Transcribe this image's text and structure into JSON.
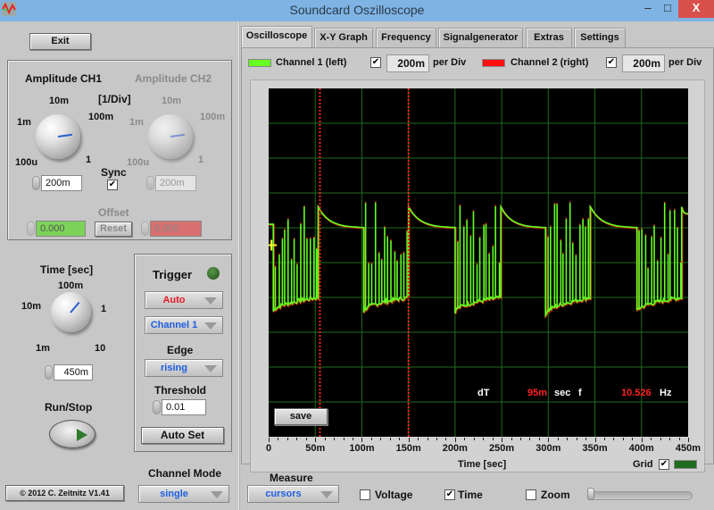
{
  "window": {
    "title": "Soundcard Oszilloscope",
    "minimize": "–",
    "maximize": "□",
    "close": "X"
  },
  "left": {
    "exit_label": "Exit",
    "amplitude": {
      "ch1_title": "Amplitude CH1",
      "ch2_title": "Amplitude CH2",
      "unit": "[1/Div]",
      "scale_labels": [
        "100u",
        "1m",
        "10m",
        "100m",
        "1"
      ],
      "ch1_value": "200m",
      "ch2_value": "200m",
      "sync_label": "Sync",
      "sync_checked": true,
      "offset_label": "Offset",
      "offset_ch1": "0.000",
      "offset_ch2": "0.000",
      "reset_label": "Reset"
    },
    "time": {
      "title": "Time [sec]",
      "scale_labels": [
        "1m",
        "10m",
        "100m",
        "1",
        "10"
      ],
      "value": "450m"
    },
    "runstop_label": "Run/Stop",
    "trigger": {
      "title": "Trigger",
      "mode": "Auto",
      "channel": "Channel 1",
      "edge_label": "Edge",
      "edge": "rising",
      "threshold_label": "Threshold",
      "threshold": "0.01",
      "autoset_label": "Auto Set"
    },
    "channel_mode_label": "Channel Mode",
    "channel_mode": "single",
    "copyright": "© 2012  C. Zeitnitz V1.41"
  },
  "tabs": [
    {
      "label": "Oscilloscope",
      "active": true
    },
    {
      "label": "X-Y Graph",
      "active": false
    },
    {
      "label": "Frequency",
      "active": false
    },
    {
      "label": "Signalgenerator",
      "active": false
    },
    {
      "label": "Extras",
      "active": false
    },
    {
      "label": "Settings",
      "active": false
    }
  ],
  "channels": {
    "ch1": {
      "label": "Channel 1 (left)",
      "enabled": true,
      "per_div": "200m",
      "per_div_unit": "per Div",
      "color": "#66ff22"
    },
    "ch2": {
      "label": "Channel 2 (right)",
      "enabled": true,
      "per_div": "200m",
      "per_div_unit": "per Div",
      "color": "#ff1111"
    }
  },
  "scope": {
    "save_label": "save",
    "xaxis_title": "Time [sec]",
    "grid_label": "Grid",
    "grid_checked": true,
    "grid_color": "#1f6b1f",
    "cursor_color": "#ff2020",
    "measurement": {
      "dt_label": "dT",
      "dt_value": "95m",
      "dt_unit": "sec",
      "f_label": "f",
      "f_value": "10.526",
      "f_unit": "Hz"
    }
  },
  "measure": {
    "label": "Measure",
    "mode": "cursors",
    "voltage_label": "Voltage",
    "voltage_checked": false,
    "time_label": "Time",
    "time_checked": true,
    "zoom_label": "Zoom",
    "zoom_checked": false,
    "zoom_slider_value": 0
  },
  "chart_data": {
    "type": "line",
    "title": "",
    "xlabel": "Time [sec]",
    "ylabel": "",
    "x_ticks": [
      "0",
      "50m",
      "100m",
      "150m",
      "200m",
      "250m",
      "300m",
      "350m",
      "400m",
      "450m"
    ],
    "xlim": [
      0,
      0.45
    ],
    "ylim_divisions": [
      -5,
      5
    ],
    "volts_per_div": 0.2,
    "grid": true,
    "cursors_x": [
      0.055,
      0.15
    ],
    "trigger_marker": {
      "x": 0.003,
      "y_div": 0.5
    },
    "series": [
      {
        "name": "Channel 1 (left)",
        "color": "#66ff22",
        "description": "periodic bursting signal: high decaying plateau alternating with low spiking burst, period ~100ms",
        "segments": [
          {
            "type": "plateau",
            "t_start": 0.0,
            "t_end": 0.005,
            "y_start_div": 1.1,
            "y_end_div": 1.1
          },
          {
            "type": "burst",
            "t_start": 0.005,
            "t_end": 0.053,
            "baseline_start_div": -1.4,
            "baseline_end_div": -1.0,
            "spike_peak_div": 1.7
          },
          {
            "type": "plateau",
            "t_start": 0.053,
            "t_end": 0.102,
            "y_start_div": 1.6,
            "y_end_div": 1.0
          },
          {
            "type": "burst",
            "t_start": 0.102,
            "t_end": 0.15,
            "baseline_start_div": -1.4,
            "baseline_end_div": -1.0,
            "spike_peak_div": 2.1
          },
          {
            "type": "plateau",
            "t_start": 0.15,
            "t_end": 0.2,
            "y_start_div": 1.6,
            "y_end_div": 1.0
          },
          {
            "type": "burst",
            "t_start": 0.2,
            "t_end": 0.249,
            "baseline_start_div": -1.4,
            "baseline_end_div": -1.0,
            "spike_peak_div": 1.7
          },
          {
            "type": "plateau",
            "t_start": 0.249,
            "t_end": 0.297,
            "y_start_div": 1.6,
            "y_end_div": 1.0
          },
          {
            "type": "burst",
            "t_start": 0.297,
            "t_end": 0.345,
            "baseline_start_div": -1.5,
            "baseline_end_div": -1.0,
            "spike_peak_div": 1.8
          },
          {
            "type": "plateau",
            "t_start": 0.345,
            "t_end": 0.395,
            "y_start_div": 1.6,
            "y_end_div": 1.0
          },
          {
            "type": "burst",
            "t_start": 0.395,
            "t_end": 0.443,
            "baseline_start_div": -1.4,
            "baseline_end_div": -1.0,
            "spike_peak_div": 1.8
          },
          {
            "type": "plateau",
            "t_start": 0.443,
            "t_end": 0.45,
            "y_start_div": 1.6,
            "y_end_div": 1.4
          }
        ]
      }
    ]
  }
}
